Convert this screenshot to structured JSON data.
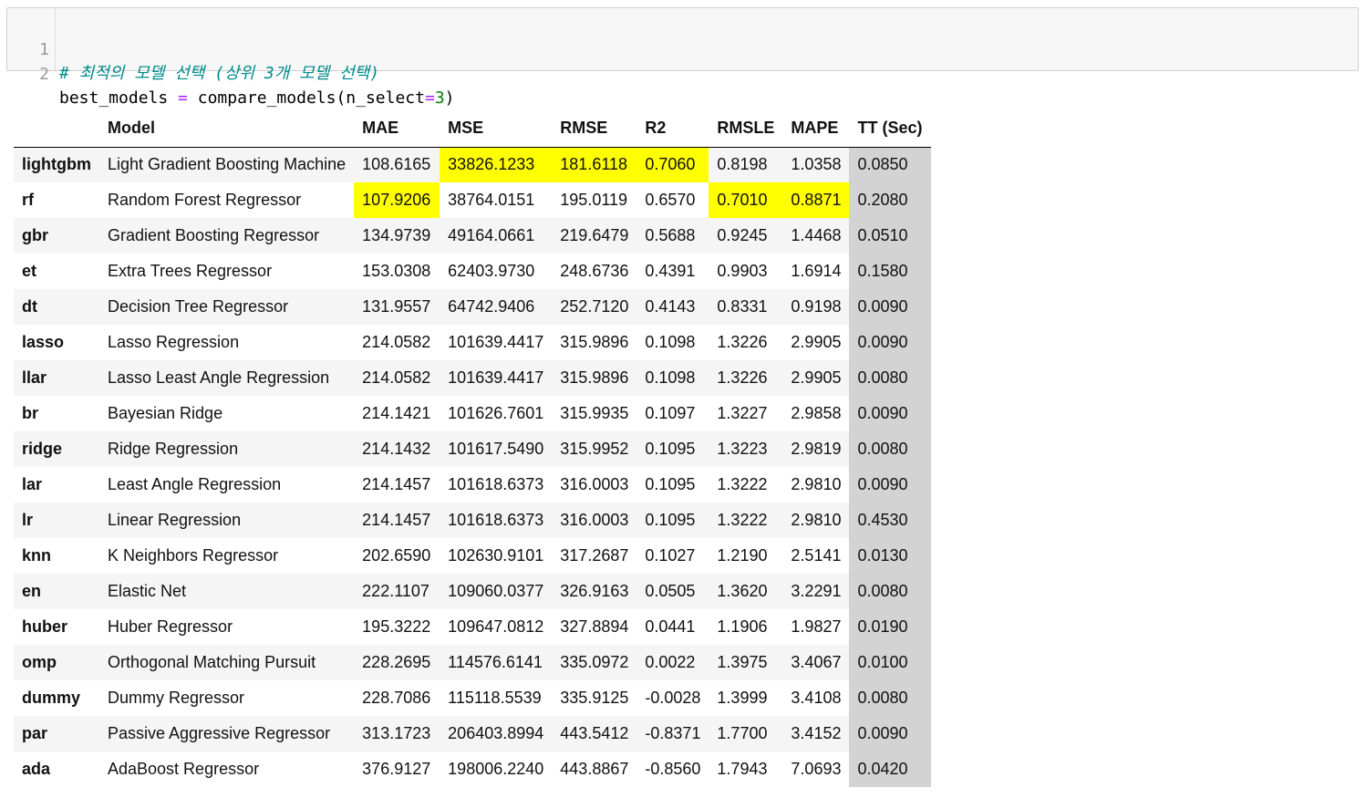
{
  "code": {
    "lines": [
      {
        "number": "1",
        "comment": "# 최적의 모델 선택 (상위 3개 모델 선택)"
      },
      {
        "number": "2",
        "var": "best_models",
        "eq": " = ",
        "func": "compare_models(n_select",
        "op": "=",
        "arg": "3",
        "close": ")"
      }
    ]
  },
  "table": {
    "columns": [
      "",
      "Model",
      "MAE",
      "MSE",
      "RMSE",
      "R2",
      "RMSLE",
      "MAPE",
      "TT (Sec)"
    ],
    "rows": [
      {
        "id": "lightgbm",
        "model": "Light Gradient Boosting Machine",
        "mae": "108.6165",
        "mse": "33826.1233",
        "rmse": "181.6118",
        "r2": "0.7060",
        "rmsle": "0.8198",
        "mape": "1.0358",
        "tt": "0.0850"
      },
      {
        "id": "rf",
        "model": "Random Forest Regressor",
        "mae": "107.9206",
        "mse": "38764.0151",
        "rmse": "195.0119",
        "r2": "0.6570",
        "rmsle": "0.7010",
        "mape": "0.8871",
        "tt": "0.2080"
      },
      {
        "id": "gbr",
        "model": "Gradient Boosting Regressor",
        "mae": "134.9739",
        "mse": "49164.0661",
        "rmse": "219.6479",
        "r2": "0.5688",
        "rmsle": "0.9245",
        "mape": "1.4468",
        "tt": "0.0510"
      },
      {
        "id": "et",
        "model": "Extra Trees Regressor",
        "mae": "153.0308",
        "mse": "62403.9730",
        "rmse": "248.6736",
        "r2": "0.4391",
        "rmsle": "0.9903",
        "mape": "1.6914",
        "tt": "0.1580"
      },
      {
        "id": "dt",
        "model": "Decision Tree Regressor",
        "mae": "131.9557",
        "mse": "64742.9406",
        "rmse": "252.7120",
        "r2": "0.4143",
        "rmsle": "0.8331",
        "mape": "0.9198",
        "tt": "0.0090"
      },
      {
        "id": "lasso",
        "model": "Lasso Regression",
        "mae": "214.0582",
        "mse": "101639.4417",
        "rmse": "315.9896",
        "r2": "0.1098",
        "rmsle": "1.3226",
        "mape": "2.9905",
        "tt": "0.0090"
      },
      {
        "id": "llar",
        "model": "Lasso Least Angle Regression",
        "mae": "214.0582",
        "mse": "101639.4417",
        "rmse": "315.9896",
        "r2": "0.1098",
        "rmsle": "1.3226",
        "mape": "2.9905",
        "tt": "0.0080"
      },
      {
        "id": "br",
        "model": "Bayesian Ridge",
        "mae": "214.1421",
        "mse": "101626.7601",
        "rmse": "315.9935",
        "r2": "0.1097",
        "rmsle": "1.3227",
        "mape": "2.9858",
        "tt": "0.0090"
      },
      {
        "id": "ridge",
        "model": "Ridge Regression",
        "mae": "214.1432",
        "mse": "101617.5490",
        "rmse": "315.9952",
        "r2": "0.1095",
        "rmsle": "1.3223",
        "mape": "2.9819",
        "tt": "0.0080"
      },
      {
        "id": "lar",
        "model": "Least Angle Regression",
        "mae": "214.1457",
        "mse": "101618.6373",
        "rmse": "316.0003",
        "r2": "0.1095",
        "rmsle": "1.3222",
        "mape": "2.9810",
        "tt": "0.0090"
      },
      {
        "id": "lr",
        "model": "Linear Regression",
        "mae": "214.1457",
        "mse": "101618.6373",
        "rmse": "316.0003",
        "r2": "0.1095",
        "rmsle": "1.3222",
        "mape": "2.9810",
        "tt": "0.4530"
      },
      {
        "id": "knn",
        "model": "K Neighbors Regressor",
        "mae": "202.6590",
        "mse": "102630.9101",
        "rmse": "317.2687",
        "r2": "0.1027",
        "rmsle": "1.2190",
        "mape": "2.5141",
        "tt": "0.0130"
      },
      {
        "id": "en",
        "model": "Elastic Net",
        "mae": "222.1107",
        "mse": "109060.0377",
        "rmse": "326.9163",
        "r2": "0.0505",
        "rmsle": "1.3620",
        "mape": "3.2291",
        "tt": "0.0080"
      },
      {
        "id": "huber",
        "model": "Huber Regressor",
        "mae": "195.3222",
        "mse": "109647.0812",
        "rmse": "327.8894",
        "r2": "0.0441",
        "rmsle": "1.1906",
        "mape": "1.9827",
        "tt": "0.0190"
      },
      {
        "id": "omp",
        "model": "Orthogonal Matching Pursuit",
        "mae": "228.2695",
        "mse": "114576.6141",
        "rmse": "335.0972",
        "r2": "0.0022",
        "rmsle": "1.3975",
        "mape": "3.4067",
        "tt": "0.0100"
      },
      {
        "id": "dummy",
        "model": "Dummy Regressor",
        "mae": "228.7086",
        "mse": "115118.5539",
        "rmse": "335.9125",
        "r2": "-0.0028",
        "rmsle": "1.3999",
        "mape": "3.4108",
        "tt": "0.0080"
      },
      {
        "id": "par",
        "model": "Passive Aggressive Regressor",
        "mae": "313.1723",
        "mse": "206403.8994",
        "rmse": "443.5412",
        "r2": "-0.8371",
        "rmsle": "1.7700",
        "mape": "3.4152",
        "tt": "0.0090"
      },
      {
        "id": "ada",
        "model": "AdaBoost Regressor",
        "mae": "376.9127",
        "mse": "198006.2240",
        "rmse": "443.8867",
        "r2": "-0.8560",
        "rmsle": "1.7943",
        "mape": "7.0693",
        "tt": "0.0420"
      }
    ],
    "highlights": {
      "best_color": "#ffff00",
      "tt_color": "#d3d3d3",
      "best_cells": [
        {
          "row": 0,
          "col": "mse"
        },
        {
          "row": 0,
          "col": "rmse"
        },
        {
          "row": 0,
          "col": "r2"
        },
        {
          "row": 1,
          "col": "mae"
        },
        {
          "row": 1,
          "col": "rmsle"
        },
        {
          "row": 1,
          "col": "mape"
        }
      ]
    }
  }
}
